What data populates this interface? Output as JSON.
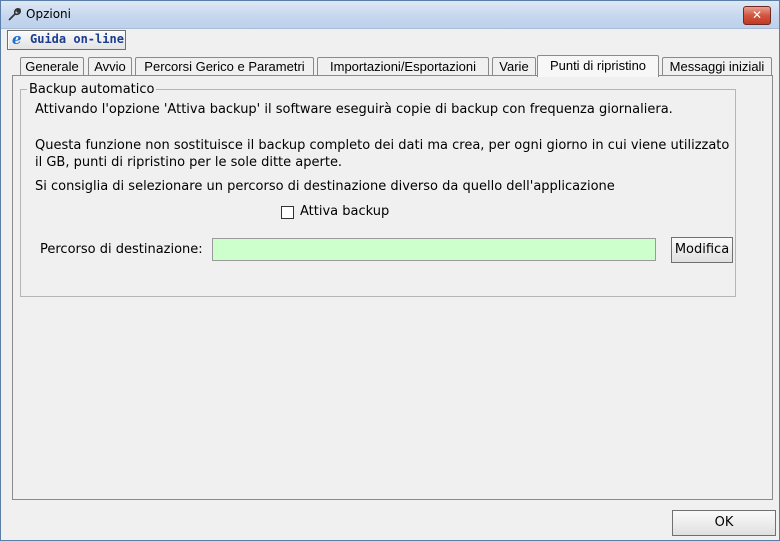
{
  "window": {
    "title": "Opzioni",
    "close_label": "✕"
  },
  "toolbar": {
    "guida_label": "Guida on-line",
    "guida_icon": "ie-icon"
  },
  "tabs": [
    {
      "label": "Generale"
    },
    {
      "label": "Avvio"
    },
    {
      "label": "Percorsi Gerico e Parametri"
    },
    {
      "label": "Importazioni/Esportazioni"
    },
    {
      "label": "Varie"
    },
    {
      "label": "Punti di ripristino",
      "active": true
    },
    {
      "label": "Messaggi iniziali"
    }
  ],
  "backup": {
    "group_title": "Backup automatico",
    "line1": "Attivando l'opzione 'Attiva backup' il software eseguirà copie di backup con frequenza giornaliera.",
    "line2": "Questa funzione non sostituisce il backup completo dei dati ma crea, per ogni giorno in cui viene utilizzato",
    "line3": "il GB, punti di ripristino per le sole ditte aperte.",
    "line4": "Si consiglia di selezionare un percorso di destinazione diverso da quello dell'applicazione",
    "checkbox_label": "Attiva backup",
    "checkbox_checked": false,
    "dest_label": "Percorso di destinazione:",
    "dest_value": "",
    "dest_bg_color": "#ccffcc",
    "modifica_label": "Modifica"
  },
  "footer": {
    "ok_label": "OK"
  }
}
